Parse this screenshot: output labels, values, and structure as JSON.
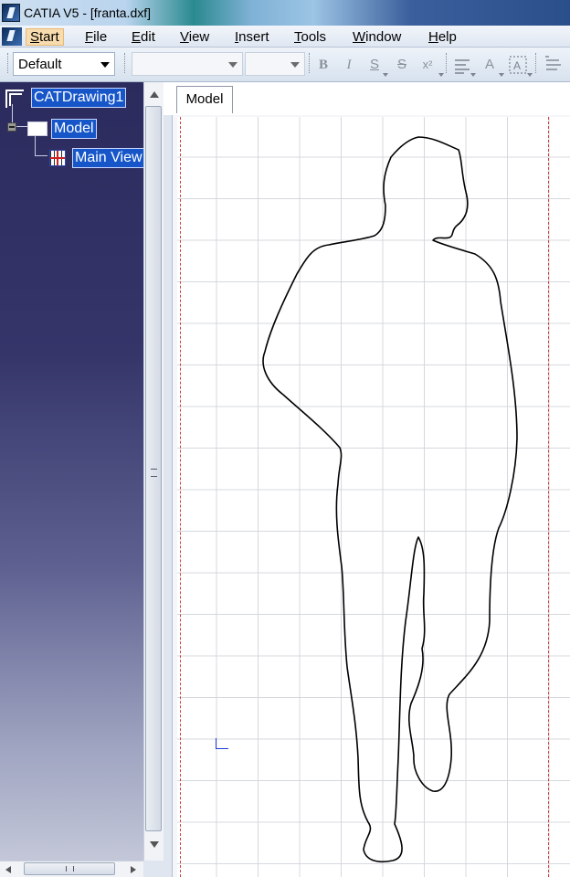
{
  "window": {
    "title": "CATIA V5 - [franta.dxf]"
  },
  "menu": [
    {
      "key": "start",
      "label": "Start",
      "u": "S",
      "rest": "tart",
      "active": true
    },
    {
      "key": "file",
      "label": "File",
      "u": "F",
      "rest": "ile"
    },
    {
      "key": "edit",
      "label": "Edit",
      "u": "E",
      "rest": "dit"
    },
    {
      "key": "view",
      "label": "View",
      "u": "V",
      "rest": "iew"
    },
    {
      "key": "insert",
      "label": "Insert",
      "u": "I",
      "rest": "nsert"
    },
    {
      "key": "tools",
      "label": "Tools",
      "u": "T",
      "rest": "ools"
    },
    {
      "key": "window",
      "label": "Window",
      "u": "W",
      "rest": "indow"
    },
    {
      "key": "help",
      "label": "Help",
      "u": "H",
      "rest": "elp"
    }
  ],
  "toolbar": {
    "style_combo": {
      "value": "Default"
    },
    "font_combo": {
      "value": ""
    },
    "size_combo": {
      "value": ""
    },
    "buttons": {
      "bold": "B",
      "italic": "I",
      "underline": "S",
      "strike": "S",
      "superscript": "x²",
      "text": "A"
    }
  },
  "tree": {
    "root": "CATDrawing1",
    "sheet": "Model",
    "view": "Main View"
  },
  "tabs": [
    {
      "label": "Model",
      "active": true
    }
  ],
  "colors": {
    "tree_top": "#2b2b5e",
    "tree_bottom": "#c3c7d8",
    "selection": "#1656c9",
    "border_dash": "#d43b3b",
    "axis": "#1e3fd8"
  },
  "icons": [
    "catia-logo-icon",
    "drawing-icon",
    "sheet-icon",
    "view-icon",
    "collapse-icon",
    "bold-icon",
    "italic-icon",
    "underline-icon",
    "strikethrough-icon",
    "superscript-icon",
    "text-frame-icon"
  ]
}
